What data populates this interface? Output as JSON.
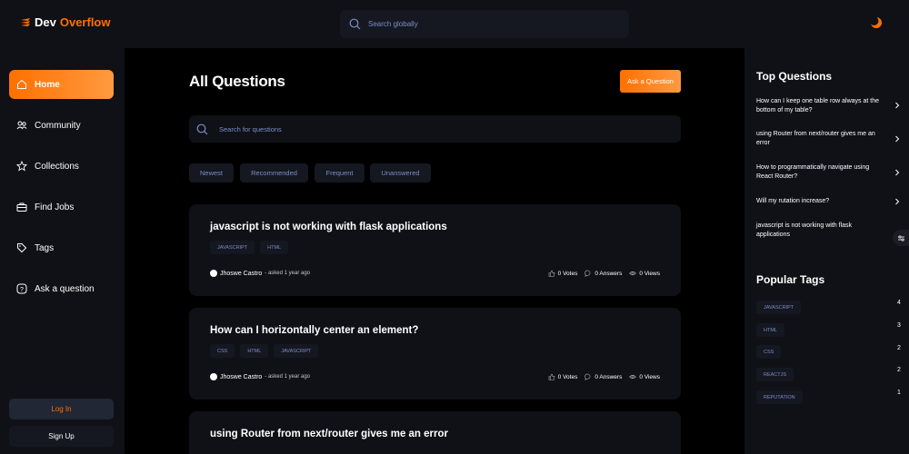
{
  "header": {
    "logo_word1": "Dev",
    "logo_word2": "Overflow",
    "search_placeholder": "Search globally"
  },
  "sidebar": {
    "items": [
      {
        "label": "Home",
        "icon": "home-icon",
        "active": true
      },
      {
        "label": "Community",
        "icon": "users-icon",
        "active": false
      },
      {
        "label": "Collections",
        "icon": "star-icon",
        "active": false
      },
      {
        "label": "Find Jobs",
        "icon": "briefcase-icon",
        "active": false
      },
      {
        "label": "Tags",
        "icon": "tag-icon",
        "active": false
      },
      {
        "label": "Ask a question",
        "icon": "question-icon",
        "active": false
      }
    ],
    "login_label": "Log In",
    "signup_label": "Sign Up"
  },
  "main": {
    "title": "All Questions",
    "ask_button": "Ask a Question",
    "search_placeholder": "Search for questions",
    "filters": [
      "Newest",
      "Recommended",
      "Frequent",
      "Unanswered"
    ],
    "questions": [
      {
        "title": "javascript is not working with flask applications",
        "tags": [
          "JAVASCRIPT",
          "HTML"
        ],
        "author": "Jhoswe Castro",
        "asked": "- asked 1 year ago",
        "votes": "0 Votes",
        "answers": "0 Answers",
        "views": "0 Views"
      },
      {
        "title": "How can I horizontally center an element?",
        "tags": [
          "CSS",
          "HTML",
          "JAVASCRIPT"
        ],
        "author": "Jhoswe Castro",
        "asked": "- asked 1 year ago",
        "votes": "0 Votes",
        "answers": "0 Answers",
        "views": "0 Views"
      },
      {
        "title": "using Router from next/router gives me an error",
        "tags": [],
        "author": "",
        "asked": "",
        "votes": "",
        "answers": "",
        "views": ""
      }
    ]
  },
  "right": {
    "top_questions_heading": "Top Questions",
    "top_questions": [
      "How can I keep one table row always at the bottom of my table?",
      "using Router from next/router gives me an error",
      "How to programmatically navigate using React Router?",
      "Will my rutation increase?",
      "javascript is not working with flask applications"
    ],
    "popular_tags_heading": "Popular Tags",
    "popular_tags": [
      {
        "name": "JAVASCRIPT",
        "count": "4"
      },
      {
        "name": "HTML",
        "count": "3"
      },
      {
        "name": "CSS",
        "count": "2"
      },
      {
        "name": "REACTJS",
        "count": "2"
      },
      {
        "name": "REPUTATION",
        "count": "1"
      }
    ]
  },
  "colors": {
    "accent": "#ff7000",
    "panel": "#0f1117",
    "chip": "#151821",
    "muted_text": "#7b8ec8"
  }
}
